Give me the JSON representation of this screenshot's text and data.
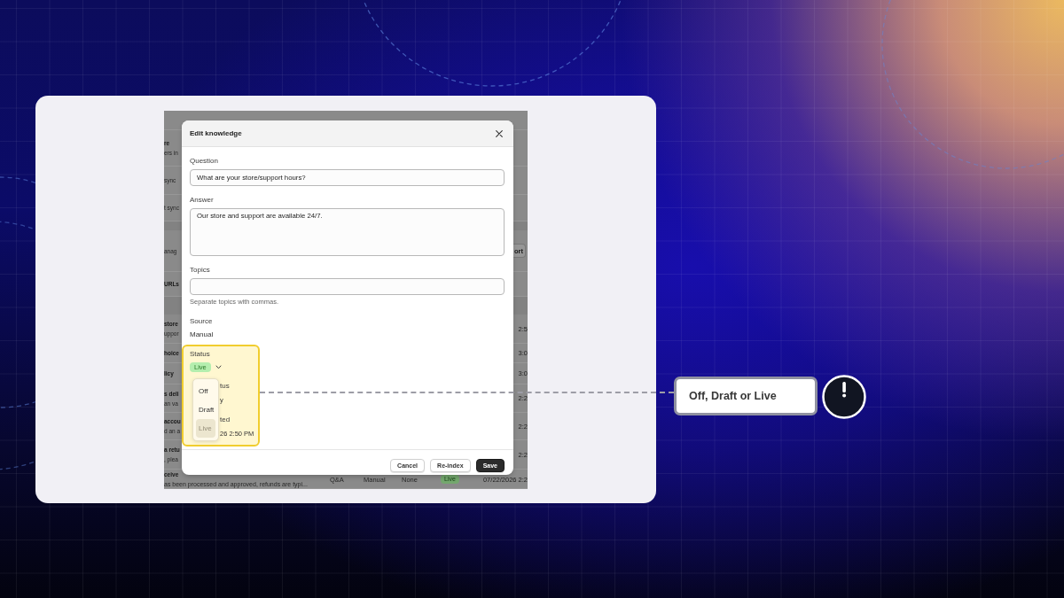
{
  "background_page": {
    "rows": [
      {
        "kind": "entry",
        "title": "re",
        "subtitle": "ers in"
      },
      {
        "kind": "entry",
        "subtitle": "sync"
      },
      {
        "kind": "entry",
        "subtitle": "t sync"
      },
      {
        "kind": "header"
      },
      {
        "kind": "entry",
        "subtitle": "anag",
        "action": "ort"
      },
      {
        "kind": "entry",
        "title": "URLs"
      },
      {
        "kind": "header"
      },
      {
        "kind": "entry",
        "title": "store",
        "subtitle": "uppor",
        "last_cell": "2:5"
      },
      {
        "kind": "entry",
        "title": "hoice",
        "last_cell": "3:0"
      },
      {
        "kind": "entry",
        "title": "licy",
        "last_cell": "3:0"
      },
      {
        "kind": "entry",
        "title": "s deli",
        "subtitle": "an va",
        "last_cell": "2:2"
      },
      {
        "kind": "entry",
        "title": "accou",
        "subtitle": "d an a",
        "last_cell": "2:2"
      },
      {
        "kind": "entry",
        "title": "a retu",
        "subtitle": ", plea",
        "last_cell": "2:2"
      },
      {
        "kind": "entry",
        "title": "ceive",
        "subtitle": "as been processed and approved, refunds are typi...",
        "cells": [
          "Q&A",
          "Manual",
          "None"
        ],
        "status_badge": "Live",
        "last_cell": "07/22/2026 2:2"
      }
    ]
  },
  "modal": {
    "title": "Edit knowledge",
    "fields": [
      {
        "kind": "input",
        "label": "Question",
        "value": "What are your store/support hours?"
      },
      {
        "kind": "textarea",
        "label": "Answer",
        "value": "Our store and support are available 24/7."
      },
      {
        "kind": "input",
        "label": "Topics",
        "help": "Separate topics with commas."
      },
      {
        "kind": "text",
        "label": "Source",
        "value": "Manual"
      },
      {
        "kind": "status",
        "label": "Status",
        "value": "Live",
        "expanded": true,
        "options": [
          {
            "label": "Off",
            "selected": false
          },
          {
            "label": "Draft",
            "selected": false
          },
          {
            "label": "Live",
            "selected": true
          }
        ]
      }
    ],
    "covered_fields": [
      {
        "label": "tus",
        "value": "y"
      },
      {
        "label": "ted",
        "value": "26 2:50 PM"
      }
    ],
    "buttons": [
      {
        "label": "Cancel",
        "kind": "secondary"
      },
      {
        "label": "Re-index",
        "kind": "secondary"
      },
      {
        "label": "Save",
        "kind": "primary"
      }
    ]
  },
  "callout": {
    "text": "Off, Draft or Live"
  }
}
